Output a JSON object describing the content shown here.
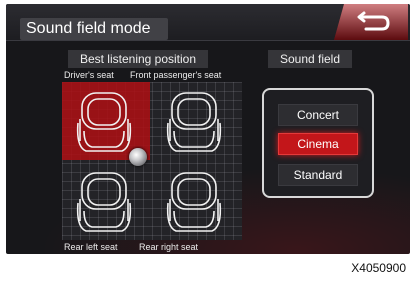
{
  "title": "Sound field mode",
  "sections": {
    "best_position_label": "Best listening position",
    "sound_field_label": "Sound field"
  },
  "seats": {
    "drivers": "Driver's seat",
    "front_passenger": "Front passenger's seat",
    "rear_left": "Rear left seat",
    "rear_right": "Rear right seat",
    "selected": "Driver's seat"
  },
  "sound_field": {
    "options": [
      "Concert",
      "Cinema",
      "Standard"
    ],
    "selected": "Cinema"
  },
  "reference_code": "X4050900",
  "colors": {
    "accent_red": "#c3161a",
    "screen_background": "#17171a"
  },
  "icons": {
    "back": "return-arrow-icon",
    "seat": "car-seat-icon",
    "position": "position-knob-icon"
  }
}
